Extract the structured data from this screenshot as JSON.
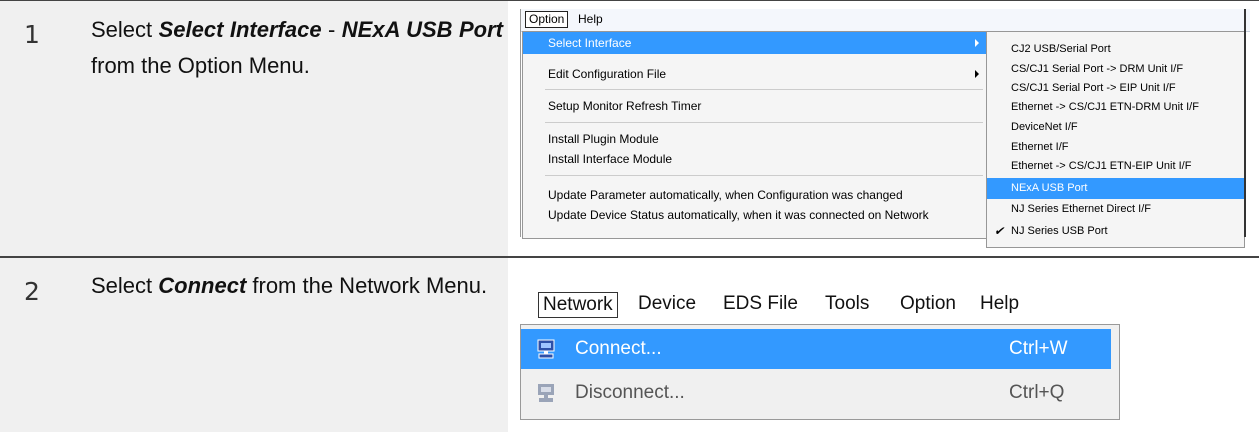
{
  "steps": [
    {
      "number": "1",
      "pre": "Select ",
      "bold1": "Select Interface",
      "mid": " - ",
      "bold2": "NExA USB Port",
      "post": " from the Option Menu."
    },
    {
      "number": "2",
      "pre": "Select ",
      "bold1": "Connect",
      "post": " from the Network Menu."
    }
  ],
  "shot1": {
    "menubar": [
      "Option",
      "Help"
    ],
    "menu": [
      "Select Interface",
      "Edit Configuration File",
      "Setup Monitor Refresh Timer",
      "Install Plugin Module",
      "Install Interface Module",
      "Update Parameter automatically, when Configuration was changed",
      "Update Device Status automatically, when it was connected on Network"
    ],
    "submenu": [
      "CJ2 USB/Serial Port",
      "CS/CJ1 Serial Port -> DRM Unit I/F",
      "CS/CJ1 Serial Port -> EIP Unit I/F",
      "Ethernet -> CS/CJ1 ETN-DRM Unit I/F",
      "DeviceNet I/F",
      "Ethernet I/F",
      "Ethernet -> CS/CJ1 ETN-EIP Unit I/F",
      "NExA USB Port",
      "NJ Series Ethernet Direct I/F",
      "NJ Series USB Port"
    ],
    "check_mark": "✔"
  },
  "shot2": {
    "menubar": [
      "Network",
      "Device",
      "EDS File",
      "Tools",
      "Option",
      "Help"
    ],
    "menu": [
      {
        "label": "Connect...",
        "shortcut": "Ctrl+W"
      },
      {
        "label": "Disconnect...",
        "shortcut": "Ctrl+Q"
      }
    ]
  },
  "colors": {
    "highlight": "#3399ff",
    "step_bg": "#f0f0f0"
  }
}
